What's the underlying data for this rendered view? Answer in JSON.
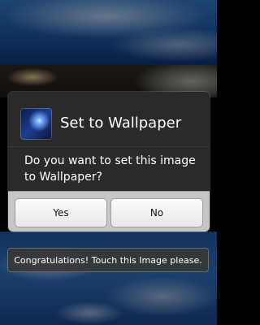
{
  "dialog": {
    "title": "Set to Wallpaper",
    "message": "Do you want to set this image to Wallpaper?",
    "yes_label": "Yes",
    "no_label": "No",
    "icon": "app-icon"
  },
  "toast": {
    "text": "Congratulations! Touch this Image please."
  },
  "colors": {
    "dialog_bg": "#2a2a2a",
    "button_bar_bg": "#c6c6c6",
    "toast_bg": "#373737"
  }
}
